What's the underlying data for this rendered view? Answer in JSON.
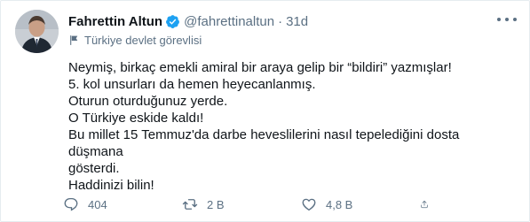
{
  "tweet": {
    "display_name": "Fahrettin Altun",
    "handle": "@fahrettinaltun",
    "separator": "·",
    "time": "31d",
    "account_label": "Türkiye devlet görevlisi",
    "lines": [
      "Neymiş, birkaç emekli amiral bir araya gelip bir “bildiri” yazmışlar!",
      "5. kol unsurları da hemen heyecanlanmış.",
      "Oturun oturduğunuz yerde.",
      "O Türkiye eskide kaldı!",
      "Bu millet 15 Temmuz'da darbe heveslilerini nasıl tepelediğini dosta düşmana",
      "gösterdi.",
      "Haddinizi bilin!"
    ],
    "stats": {
      "replies": "404",
      "retweets": "2 B",
      "likes": "4,8 B"
    }
  },
  "colors": {
    "verified": "#1da1f2",
    "muted": "#5b7083",
    "text": "#0f1419",
    "border": "#e6ecf0"
  },
  "icons": {
    "verified": "verified-badge-icon",
    "label": "flag-icon",
    "more": "more-icon",
    "reply": "reply-icon",
    "retweet": "retweet-icon",
    "like": "heart-icon",
    "share": "share-icon"
  }
}
